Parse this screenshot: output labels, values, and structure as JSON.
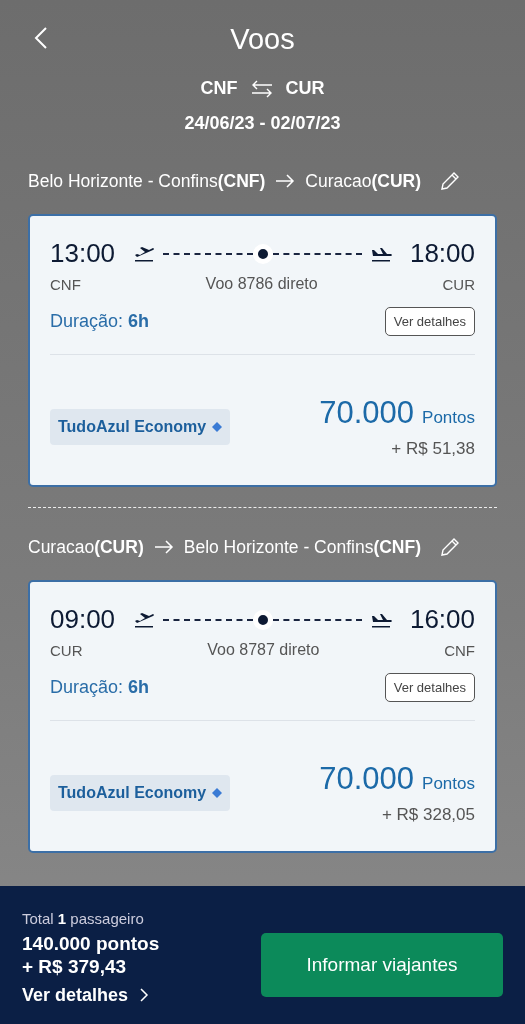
{
  "header": {
    "title": "Voos"
  },
  "trip": {
    "origin": "CNF",
    "destination": "CUR",
    "dates": "24/06/23 - 02/07/23"
  },
  "segments": [
    {
      "from": "Belo Horizonte - Confins**(CNF)**",
      "to": "Curacao**(CUR)**",
      "departure_time": "13:00",
      "arrival_time": "18:00",
      "departure_code": "CNF",
      "arrival_code": "CUR",
      "flight": "Voo 8786 direto",
      "duration_label": "Duração:",
      "duration": "6h",
      "details_button": "Ver detalhes",
      "fare_class": "TudoAzul Economy",
      "points": "70.000",
      "points_unit": "Pontos",
      "cash": "+ R$ 51,38"
    },
    {
      "from": "Curacao**(CUR)**",
      "to": "Belo Horizonte - Confins**(CNF)**",
      "departure_time": "09:00",
      "arrival_time": "16:00",
      "departure_code": "CUR",
      "arrival_code": "CNF",
      "flight": "Voo 8787 direto",
      "duration_label": "Duração:",
      "duration": "6h",
      "details_button": "Ver detalhes",
      "fare_class": "TudoAzul Economy",
      "points": "70.000",
      "points_unit": "Pontos",
      "cash": "+ R$ 328,05"
    }
  ],
  "footer": {
    "passengers": "Total **1** passageiro",
    "total_points": "140.000 pontos",
    "total_cash": "+ R$ 379,43",
    "details_link": "Ver detalhes",
    "continue_button": "Informar viajantes"
  }
}
